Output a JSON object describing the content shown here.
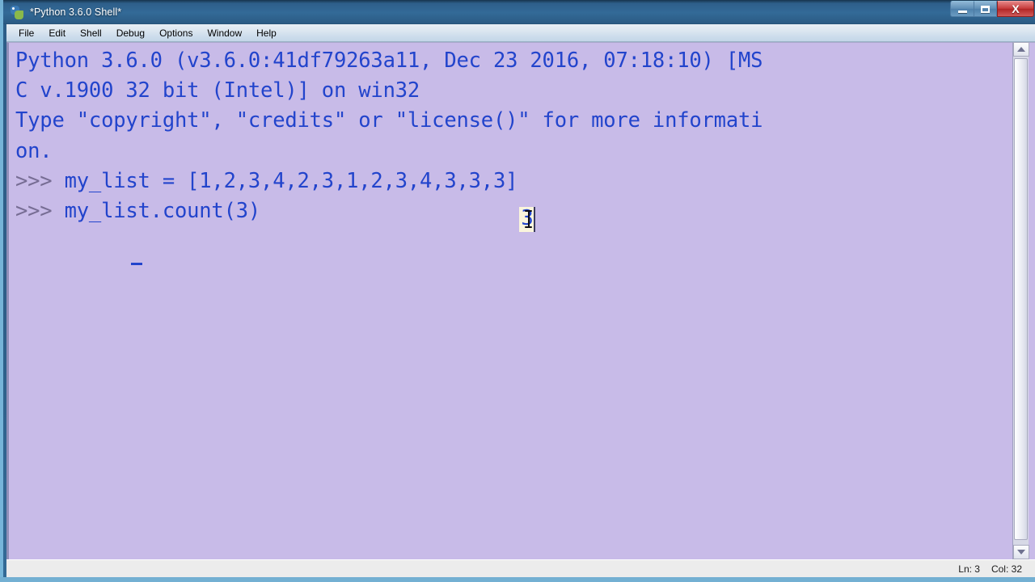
{
  "window": {
    "title": "*Python 3.6.0 Shell*",
    "icon": "python-logo-icon",
    "caption": {
      "minimize_label": "–",
      "maximize_label": "□",
      "close_label": "X"
    }
  },
  "menu": {
    "items": [
      {
        "label": "File"
      },
      {
        "label": "Edit"
      },
      {
        "label": "Shell"
      },
      {
        "label": "Debug"
      },
      {
        "label": "Options"
      },
      {
        "label": "Window"
      },
      {
        "label": "Help"
      }
    ]
  },
  "shell": {
    "banner_lines": [
      "Python 3.6.0 (v3.6.0:41df79263a11, Dec 23 2016, 07:18:10) [MS",
      "C v.1900 32 bit (Intel)] on win32",
      "Type \"copyright\", \"credits\" or \"license()\" for more informati",
      "on."
    ],
    "prompt": ">>>",
    "entries": [
      {
        "prompt": ">>> ",
        "code": "my_list = [1,2,3,4,2,3,1,2,3,4,3,3,3]"
      },
      {
        "prompt": ">>> ",
        "code": "my_list.count(3)"
      }
    ],
    "hovered_char": "3",
    "list_value": "[1,2,3,4,2,3,1,2,3,4,3,3,3]",
    "colors": {
      "background": "#c8bbe8",
      "code_text": "#2244cc",
      "prompt_text": "#776d94",
      "hover_highlight": "#faf5dc"
    }
  },
  "scrollbar": {
    "up_arrow": "arrow-up-icon",
    "down_arrow": "arrow-down-icon"
  },
  "status_bar": {
    "line_label": "Ln: 3",
    "col_label": "Col: 32"
  }
}
